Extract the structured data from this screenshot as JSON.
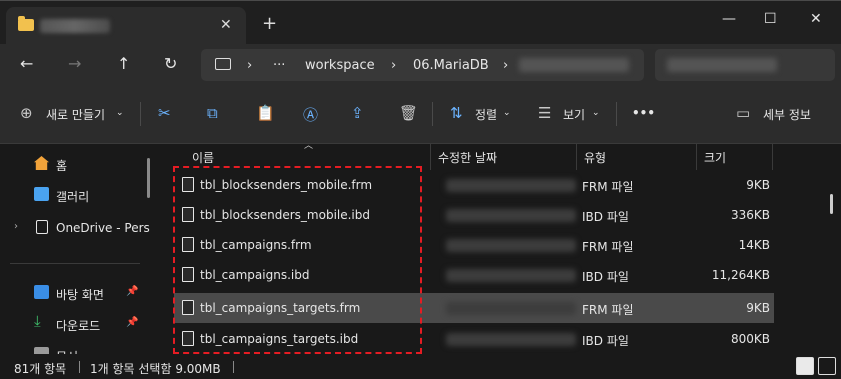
{
  "window": {
    "minimize": "—",
    "maximize": "☐",
    "close": "✕",
    "new_tab": "+",
    "tab_close": "✕"
  },
  "nav": {
    "back": "←",
    "forward": "→",
    "up": "↑",
    "refresh": "↻",
    "breadcrumb": [
      "workspace",
      "06.MariaDB"
    ],
    "more": "···",
    "sep": "›"
  },
  "toolbar": {
    "new": "새로 만들기",
    "sort": "정렬",
    "view": "보기",
    "more": "•••",
    "details": "세부 정보",
    "icons": [
      "cut-icon",
      "copy-icon",
      "paste-icon",
      "rename-icon",
      "share-icon",
      "delete-icon"
    ]
  },
  "sidebar": {
    "items": [
      {
        "label": "홈",
        "icon": "home-icon",
        "color": "#f2a33a"
      },
      {
        "label": "갤러리",
        "icon": "gallery-icon",
        "color": "#4aa3f0"
      },
      {
        "label": "OneDrive - Pers",
        "icon": "onedrive-icon",
        "color": "#e6e6e6"
      },
      {
        "label": "바탕 화면",
        "icon": "desktop-icon",
        "color": "#3a8ee6"
      },
      {
        "label": "다운로드",
        "icon": "download-icon",
        "color": "#3fbf6a"
      },
      {
        "label": "문서",
        "icon": "documents-icon",
        "color": "#9a9a9a"
      }
    ]
  },
  "columns": {
    "name": "이름",
    "date": "수정한 날짜",
    "type": "유형",
    "size": "크기"
  },
  "files": [
    {
      "name": "tbl_blocksenders_mobile.frm",
      "type": "FRM 파일",
      "size": "9KB"
    },
    {
      "name": "tbl_blocksenders_mobile.ibd",
      "type": "IBD 파일",
      "size": "336KB"
    },
    {
      "name": "tbl_campaigns.frm",
      "type": "FRM 파일",
      "size": "14KB"
    },
    {
      "name": "tbl_campaigns.ibd",
      "type": "IBD 파일",
      "size": "11,264KB"
    },
    {
      "name": "tbl_campaigns_targets.frm",
      "type": "FRM 파일",
      "size": "9KB"
    },
    {
      "name": "tbl_campaigns_targets.ibd",
      "type": "IBD 파일",
      "size": "800KB"
    }
  ],
  "status": {
    "count": "81개 항목",
    "selected": "1개 항목 선택함 9.00MB"
  }
}
